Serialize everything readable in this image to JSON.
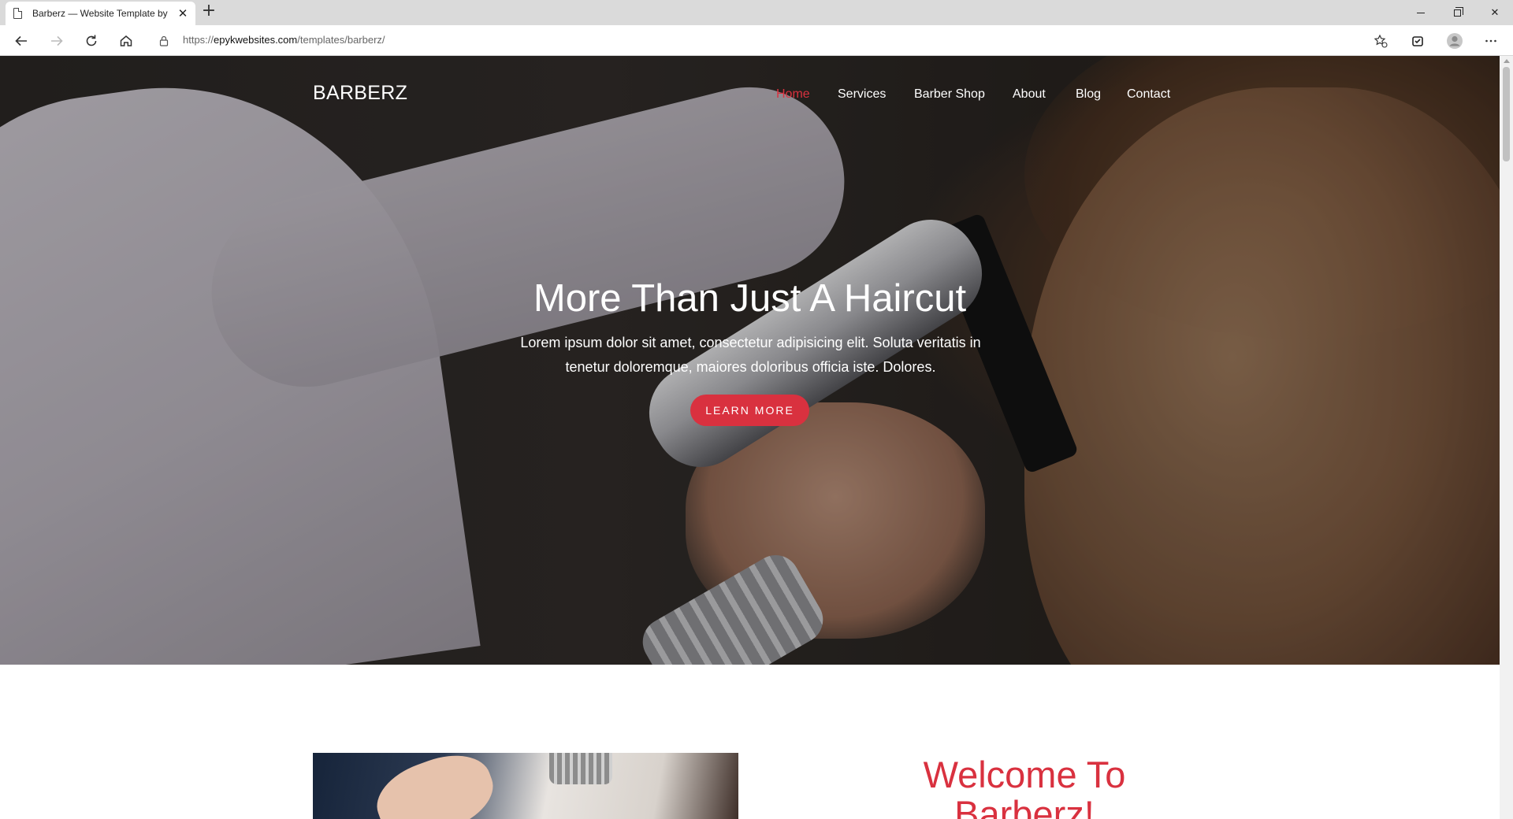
{
  "browser": {
    "tab_title": "Barberz — Website Template by",
    "url_prefix": "https://",
    "url_host": "epykwebsites.com",
    "url_path": "/templates/barberz/"
  },
  "site": {
    "brand": "BARBERZ",
    "nav": [
      "Home",
      "Services",
      "Barber Shop",
      "About",
      "Blog",
      "Contact"
    ],
    "active_nav": "Home",
    "accent_color": "#d9313f"
  },
  "hero": {
    "title": "More Than Just A Haircut",
    "subtitle": "Lorem ipsum dolor sit amet, consectetur adipisicing elit. Soluta veritatis in tenetur doloremque, maiores doloribus officia iste. Dolores.",
    "cta_label": "LEARN MORE"
  },
  "welcome": {
    "title": "Welcome To Barberz!"
  }
}
